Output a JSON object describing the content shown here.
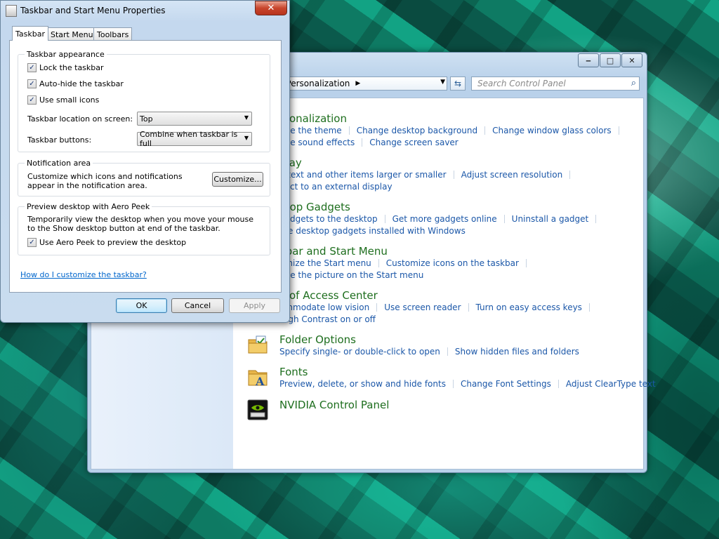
{
  "control_panel": {
    "window_controls": {
      "minimize": "‒",
      "maximize": "□",
      "close": "✕"
    },
    "address": "d Personalization",
    "search_placeholder": "Search Control Panel",
    "sections": [
      {
        "title": "rsonalization",
        "links": [
          "nge the theme",
          "Change desktop background",
          "Change window glass colors",
          "nge sound effects",
          "Change screen saver"
        ]
      },
      {
        "title": "play",
        "links": [
          "e text and other items larger or smaller",
          "Adjust screen resolution",
          "nect to an external display"
        ]
      },
      {
        "title": "ktop Gadgets",
        "links": [
          "gadgets to the desktop",
          "Get more gadgets online",
          "Uninstall a gadget",
          "ore desktop gadgets installed with Windows"
        ]
      },
      {
        "title": "kbar and Start Menu",
        "links": [
          "omize the Start menu",
          "Customize icons on the taskbar",
          "nge the picture on the Start menu"
        ]
      },
      {
        "title": "e of Access Center",
        "links": [
          "ommodate low vision",
          "Use screen reader",
          "Turn on easy access keys",
          "High Contrast on or off"
        ]
      },
      {
        "title": "Folder Options",
        "links": [
          "Specify single- or double-click to open",
          "Show hidden files and folders"
        ]
      },
      {
        "title": "Fonts",
        "links": [
          "Preview, delete, or show and hide fonts",
          "Change Font Settings",
          "Adjust ClearType text"
        ]
      },
      {
        "title": "NVIDIA Control Panel",
        "links": []
      }
    ]
  },
  "dialog": {
    "title": "Taskbar and Start Menu Properties",
    "close_label": "✕",
    "tabs": [
      "Taskbar",
      "Start Menu",
      "Toolbars"
    ],
    "appearance": {
      "label": "Taskbar appearance",
      "lock": "Lock the taskbar",
      "autohide": "Auto-hide the taskbar",
      "small_icons": "Use small icons",
      "location_label": "Taskbar location on screen:",
      "location_value": "Top",
      "buttons_label": "Taskbar buttons:",
      "buttons_value": "Combine when taskbar is full"
    },
    "notification": {
      "label": "Notification area",
      "text": "Customize which icons and notifications appear in the notification area.",
      "button": "Customize..."
    },
    "aero": {
      "label": "Preview desktop with Aero Peek",
      "text": "Temporarily view the desktop when you move your mouse to the Show desktop button at end of the taskbar.",
      "checkbox": "Use Aero Peek to preview the desktop"
    },
    "help_link": "How do I customize the taskbar?",
    "ok": "OK",
    "cancel": "Cancel",
    "apply": "Apply",
    "check_glyph": "✓"
  }
}
